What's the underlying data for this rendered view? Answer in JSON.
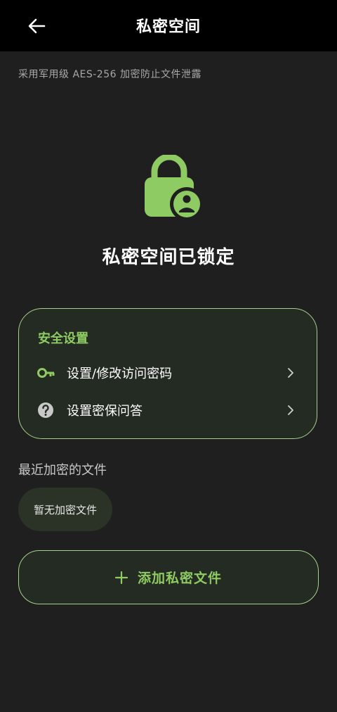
{
  "header": {
    "title": "私密空间",
    "back_icon": "arrow-left-icon"
  },
  "subtitle": "采用军用级 AES-256 加密防止文件泄露",
  "lock_status": {
    "icon": "lock-user-icon",
    "title": "私密空间已锁定"
  },
  "security_settings": {
    "title": "安全设置",
    "items": [
      {
        "label": "设置/修改访问密码",
        "icon": "key-icon"
      },
      {
        "label": "设置密保问答",
        "icon": "question-circle-icon"
      }
    ]
  },
  "recent_files": {
    "title": "最近加密的文件",
    "empty_text": "暂无加密文件"
  },
  "add_button": {
    "label": "添加私密文件",
    "icon": "plus-icon"
  },
  "colors": {
    "accent": "#8ecb62",
    "border": "#a6d18a",
    "background": "#1f1f1f",
    "topbar": "#000000",
    "card": "#242b22"
  }
}
